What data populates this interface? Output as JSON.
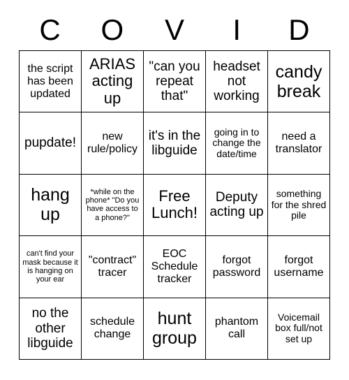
{
  "header": {
    "letters": [
      "C",
      "O",
      "V",
      "I",
      "D"
    ]
  },
  "grid": {
    "columns": 5,
    "rows": 5,
    "border_color": "#000000",
    "background_color": "#ffffff",
    "text_color": "#000000",
    "free_space_index": 12,
    "cells": [
      {
        "text": "the script has been updated",
        "size": "md"
      },
      {
        "text": "ARIAS acting up",
        "size": "xl"
      },
      {
        "text": "\"can you repeat that\"",
        "size": "lg"
      },
      {
        "text": "headset not working",
        "size": "lg"
      },
      {
        "text": "candy break",
        "size": "xxl"
      },
      {
        "text": "pupdate!",
        "size": "lg"
      },
      {
        "text": "new rule/policy",
        "size": "md"
      },
      {
        "text": "it's in the libguide",
        "size": "lg"
      },
      {
        "text": "going in to change the date/time",
        "size": "sm"
      },
      {
        "text": "need a translator",
        "size": "md"
      },
      {
        "text": "hang up",
        "size": "xxl"
      },
      {
        "text": "*while on the phone* \"Do you have access to a phone?\"",
        "size": "xxs"
      },
      {
        "text": "Free Lunch!",
        "size": "xl"
      },
      {
        "text": "Deputy acting up",
        "size": "lg"
      },
      {
        "text": "something for the shred pile",
        "size": "sm"
      },
      {
        "text": "can't find your mask because it is hanging on your ear",
        "size": "xxs"
      },
      {
        "text": "\"contract\" tracer",
        "size": "md"
      },
      {
        "text": "EOC Schedule tracker",
        "size": "md"
      },
      {
        "text": "forgot password",
        "size": "md"
      },
      {
        "text": "forgot username",
        "size": "md"
      },
      {
        "text": "no the other libguide",
        "size": "lg"
      },
      {
        "text": "schedule change",
        "size": "md"
      },
      {
        "text": "hunt group",
        "size": "xxl"
      },
      {
        "text": "phantom call",
        "size": "md"
      },
      {
        "text": "Voicemail box full/not set up",
        "size": "sm"
      }
    ]
  }
}
